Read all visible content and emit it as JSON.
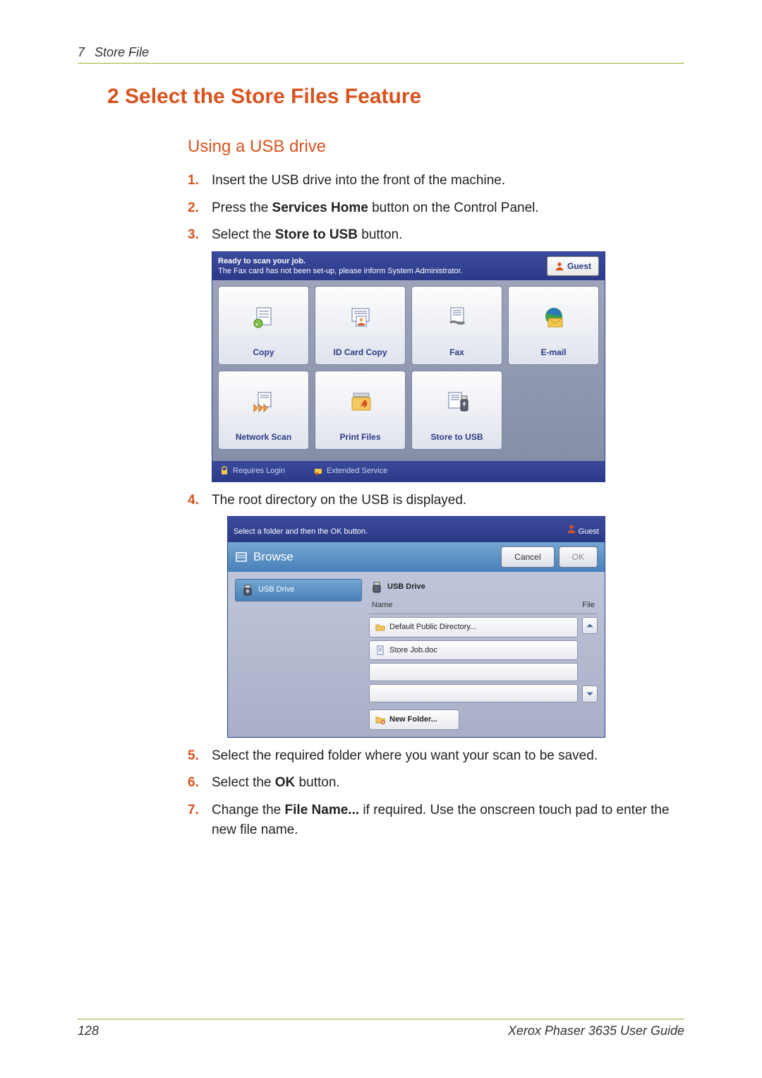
{
  "page_header": {
    "chapter_num": "7",
    "chapter_title": "Store File"
  },
  "heading_number": "2",
  "heading_title": "Select the Store Files Feature",
  "subheading": "Using a USB drive",
  "steps": [
    {
      "num": "1.",
      "parts": [
        "Insert the USB drive into the front of the machine."
      ]
    },
    {
      "num": "2.",
      "parts": [
        "Press the ",
        "Services Home",
        " button on the Control Panel."
      ]
    },
    {
      "num": "3.",
      "parts": [
        "Select the ",
        "Store to USB",
        " button."
      ]
    },
    {
      "num": "4.",
      "parts": [
        "The root directory on the USB is displayed."
      ]
    },
    {
      "num": "5.",
      "parts": [
        "Select the required folder where you want your scan to be saved."
      ]
    },
    {
      "num": "6.",
      "parts": [
        "Select the ",
        "OK",
        " button."
      ]
    },
    {
      "num": "7.",
      "parts": [
        "Change the ",
        "File Name...",
        " if required. Use the onscreen touch pad to enter the new file name."
      ]
    }
  ],
  "screenshot1": {
    "status_ready": "Ready to scan your job.",
    "status_fax": "The Fax card has not been set-up, please inform System Administrator.",
    "guest": "Guest",
    "tiles_row1": [
      "Copy",
      "ID Card Copy",
      "Fax",
      "E-mail"
    ],
    "tiles_row2": [
      "Network Scan",
      "Print Files",
      "Store to USB"
    ],
    "footer": {
      "requires_login": "Requires Login",
      "extended": "Extended Service"
    }
  },
  "screenshot2": {
    "prompt": "Select a folder and then the OK button.",
    "guest": "Guest",
    "browse": "Browse",
    "cancel": "Cancel",
    "ok": "OK",
    "left_drive": "USB Drive",
    "right_drive": "USB Drive",
    "col_name": "Name",
    "col_file": "File",
    "rows": [
      "Default Public Directory...",
      "Store Job.doc"
    ],
    "new_folder": "New Folder..."
  },
  "footer": {
    "page_num": "128",
    "guide": "Xerox Phaser 3635 User Guide"
  }
}
